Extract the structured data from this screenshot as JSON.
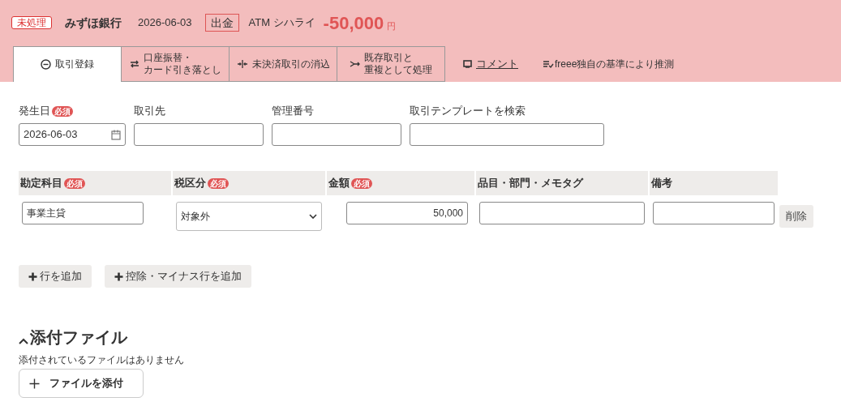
{
  "header": {
    "status_badge": "未処理",
    "bank": "みずほ銀行",
    "date": "2026-06-03",
    "direction": "出金",
    "description": "ATM シハライ",
    "amount": "-50,000",
    "currency": "円"
  },
  "tabs": [
    {
      "kind": "register",
      "label": "取引登録",
      "selected": true
    },
    {
      "kind": "transfer",
      "lines": [
        "口座振替・",
        "カード引き落とし"
      ],
      "selected": false
    },
    {
      "kind": "clear",
      "label": "未決済取引の消込",
      "selected": false
    },
    {
      "kind": "merge",
      "lines": [
        "既存取引と",
        "重複として処理"
      ],
      "selected": false
    }
  ],
  "links": [
    {
      "kind": "comment",
      "label": "コメント"
    },
    {
      "kind": "guess",
      "label": "freee独自の基準により推測"
    }
  ],
  "fields": [
    {
      "label": "発生日",
      "required_badge": "必須",
      "value": "2026-06-03",
      "kind": "date"
    },
    {
      "label": "取引先",
      "kind": "text"
    },
    {
      "label": "管理番号",
      "kind": "text"
    },
    {
      "label": "取引テンプレートを検索",
      "kind": "wide"
    }
  ],
  "table": {
    "columns": [
      {
        "label": "勘定科目",
        "required_badge": "必須"
      },
      {
        "label": "税区分",
        "required_badge": "必須"
      },
      {
        "label": "金額",
        "required_badge": "必須"
      },
      {
        "label": "品目・部門・メモタグ"
      },
      {
        "label": "備考"
      }
    ],
    "rows": [
      {
        "account": "事業主貸",
        "tax": "対象外",
        "amount": "50,000",
        "delete": "削除"
      }
    ]
  },
  "add_buttons": [
    "行を追加",
    "控除・マイナス行を追加"
  ],
  "attachments": {
    "title": "添付ファイル",
    "expanded": true,
    "empty_text": "添付されているファイルはありません",
    "button": "ファイルを添付"
  }
}
